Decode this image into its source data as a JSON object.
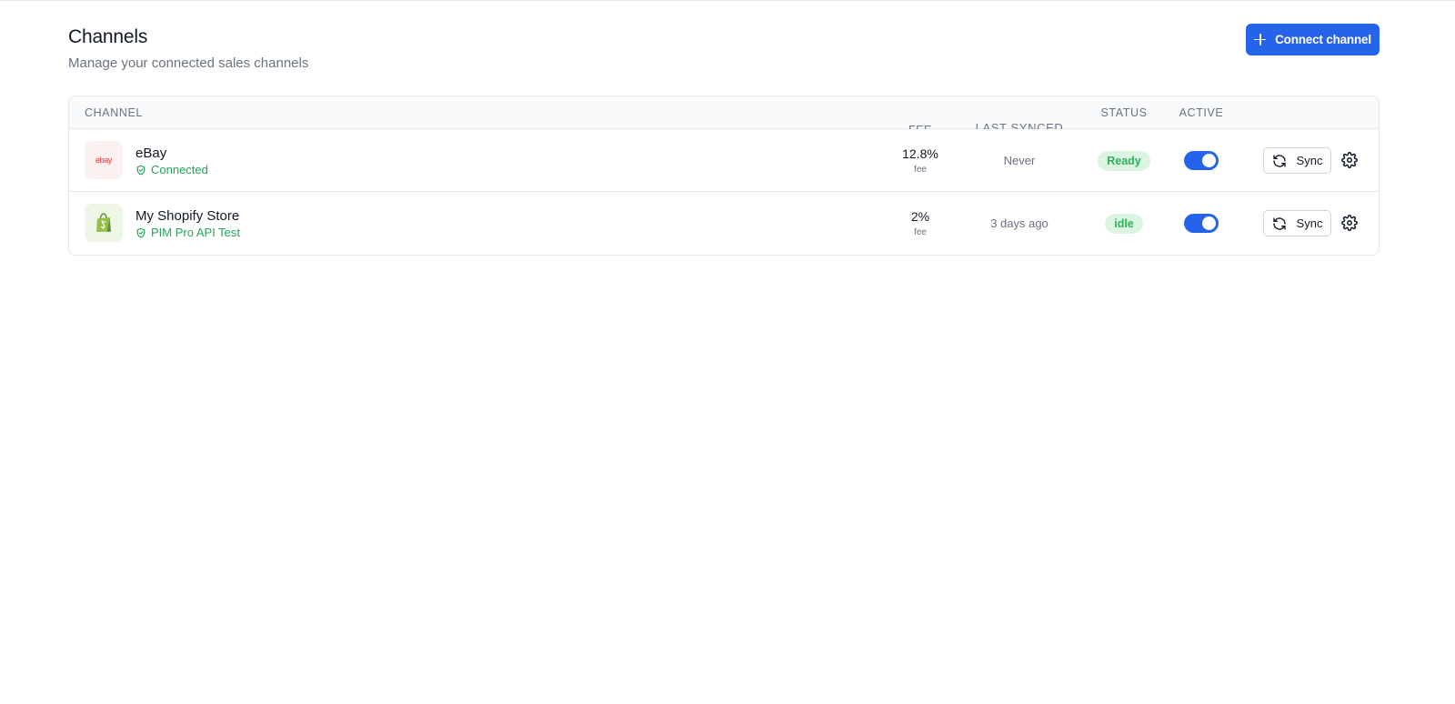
{
  "header": {
    "title": "Channels",
    "subtitle": "Manage your connected sales channels",
    "connect_label": "Connect channel"
  },
  "table": {
    "columns": {
      "channel": "Channel",
      "fee": "Fee",
      "last_synced": "Last synced",
      "status": "Status",
      "active": "Active"
    },
    "rows": [
      {
        "name": "eBay",
        "logo_text": "ebay",
        "subtitle": "Connected",
        "fee": "12.8%",
        "fee_label": "fee",
        "last_synced": "Never",
        "status": "Ready",
        "active": true,
        "sync_label": "Sync"
      },
      {
        "name": "My Shopify Store",
        "logo_text": "",
        "subtitle": "PIM Pro API Test",
        "fee": "2%",
        "fee_label": "fee",
        "last_synced": "3 days ago",
        "status": "idle",
        "active": true,
        "sync_label": "Sync"
      }
    ]
  },
  "colors": {
    "accent": "#2563eb",
    "success": "#22a55a",
    "badge_bg": "#dcf5e3"
  },
  "icons": {
    "connect": "plus-icon",
    "connected": "shield-check-icon",
    "sync": "refresh-icon",
    "settings": "gear-icon",
    "ebay": "ebay-logo",
    "shopify": "shopify-bag-icon"
  }
}
